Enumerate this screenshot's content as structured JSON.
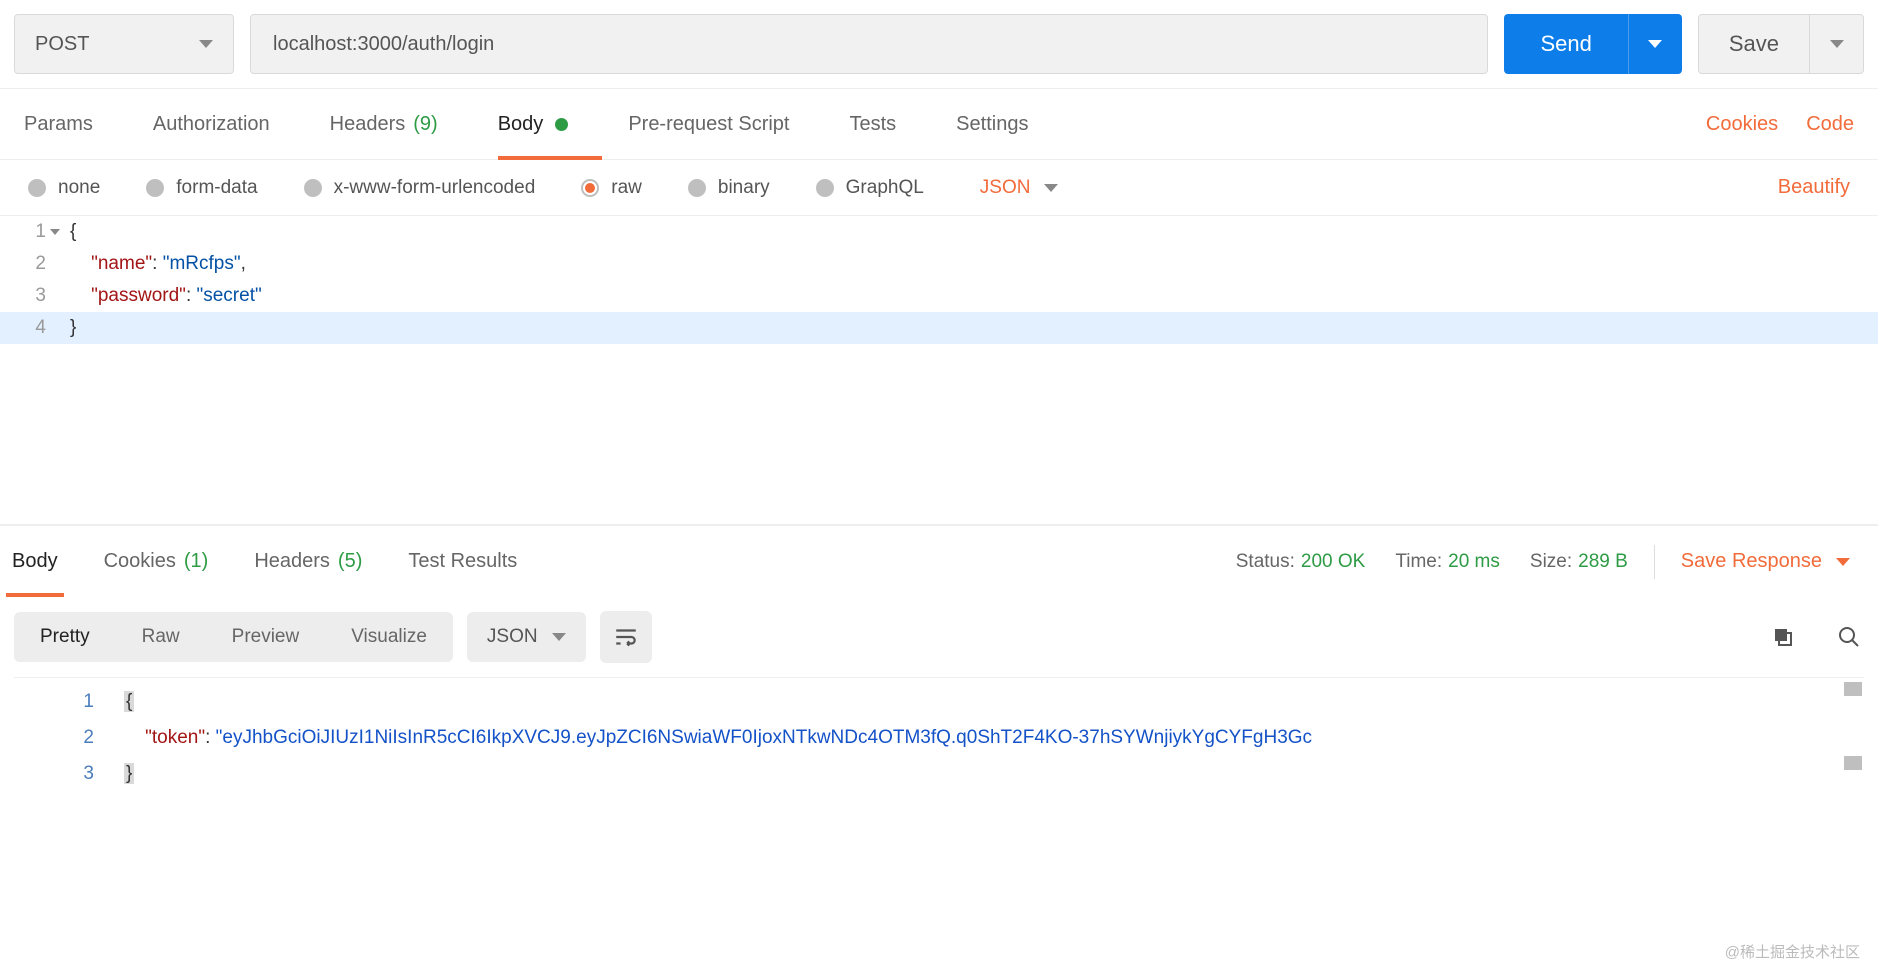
{
  "request": {
    "method": "POST",
    "url": "localhost:3000/auth/login",
    "send_label": "Send",
    "save_label": "Save"
  },
  "req_tabs": {
    "params": "Params",
    "authorization": "Authorization",
    "headers": "Headers",
    "headers_count": "(9)",
    "body": "Body",
    "prerequest": "Pre-request Script",
    "tests": "Tests",
    "settings": "Settings",
    "cookies_link": "Cookies",
    "code_link": "Code"
  },
  "body_types": {
    "none": "none",
    "form_data": "form-data",
    "urlencoded": "x-www-form-urlencoded",
    "raw": "raw",
    "binary": "binary",
    "graphql": "GraphQL",
    "lang": "JSON",
    "beautify": "Beautify"
  },
  "request_body": {
    "line1_num": "1",
    "line2_num": "2",
    "line3_num": "3",
    "line4_num": "4",
    "key_name": "\"name\"",
    "val_name": "\"mRcfps\"",
    "key_password": "\"password\"",
    "val_password": "\"secret\""
  },
  "resp_tabs": {
    "body": "Body",
    "cookies": "Cookies",
    "cookies_count": "(1)",
    "headers": "Headers",
    "headers_count": "(5)",
    "test_results": "Test Results"
  },
  "resp_meta": {
    "status_label": "Status:",
    "status_value": "200 OK",
    "time_label": "Time:",
    "time_value": "20 ms",
    "size_label": "Size:",
    "size_value": "289 B",
    "save_response": "Save Response"
  },
  "resp_toolbar": {
    "pretty": "Pretty",
    "raw": "Raw",
    "preview": "Preview",
    "visualize": "Visualize",
    "lang": "JSON"
  },
  "response_body": {
    "line1_num": "1",
    "line2_num": "2",
    "line3_num": "3",
    "key_token": "\"token\"",
    "val_token": "\"eyJhbGciOiJIUzI1NiIsInR5cCI6IkpXVCJ9.eyJpZCI6NSwiaWF0IjoxNTkwNDc4OTM3fQ.q0ShT2F4KO-37hSYWnjiykYgCYFgH3Gc"
  },
  "watermark": "@稀土掘金技术社区"
}
